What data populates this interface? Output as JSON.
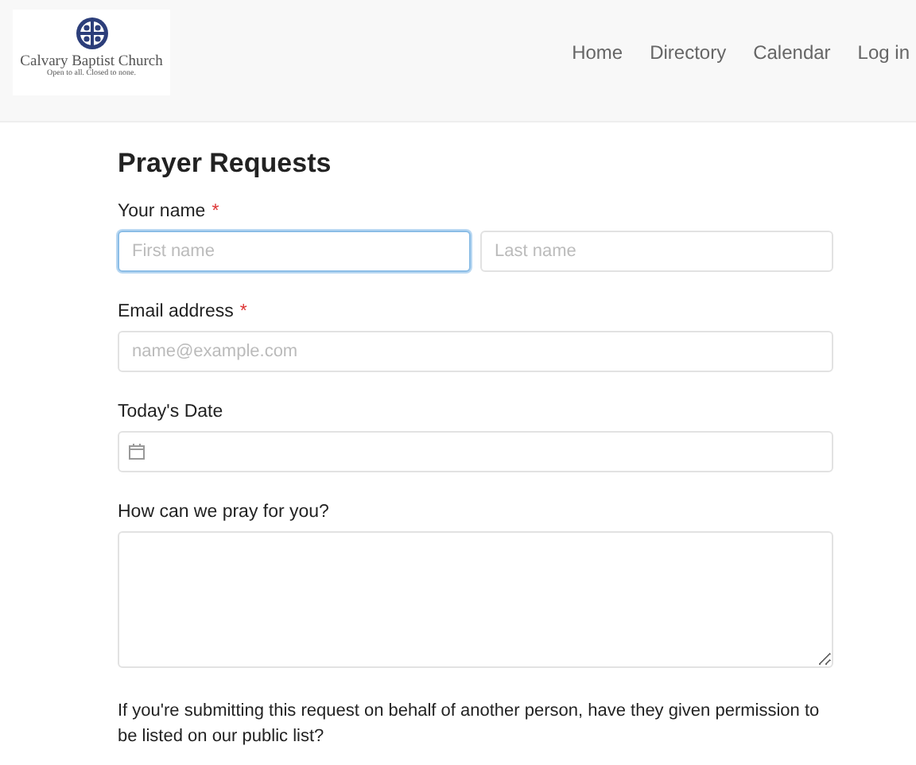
{
  "header": {
    "logo": {
      "name": "Calvary Baptist Church",
      "tagline": "Open to all. Closed to none."
    },
    "nav": [
      {
        "label": "Home"
      },
      {
        "label": "Directory"
      },
      {
        "label": "Calendar"
      },
      {
        "label": "Log in"
      }
    ]
  },
  "form": {
    "title": "Prayer Requests",
    "fields": [
      {
        "kind": "name",
        "label": "Your name",
        "required_mark": "*",
        "inputs": [
          {
            "placeholder": "First name",
            "focused": true
          },
          {
            "placeholder": "Last name",
            "focused": false
          }
        ]
      },
      {
        "kind": "text",
        "label": "Email address",
        "required_mark": "*",
        "inputs": [
          {
            "placeholder": "name@example.com",
            "focused": false
          }
        ]
      },
      {
        "kind": "date",
        "label": "Today's Date"
      },
      {
        "kind": "textarea",
        "label": "How can we pray for you?"
      },
      {
        "kind": "question",
        "label": "If you're submitting this request on behalf of another person, have they given permission to be listed on our public list?"
      }
    ]
  }
}
